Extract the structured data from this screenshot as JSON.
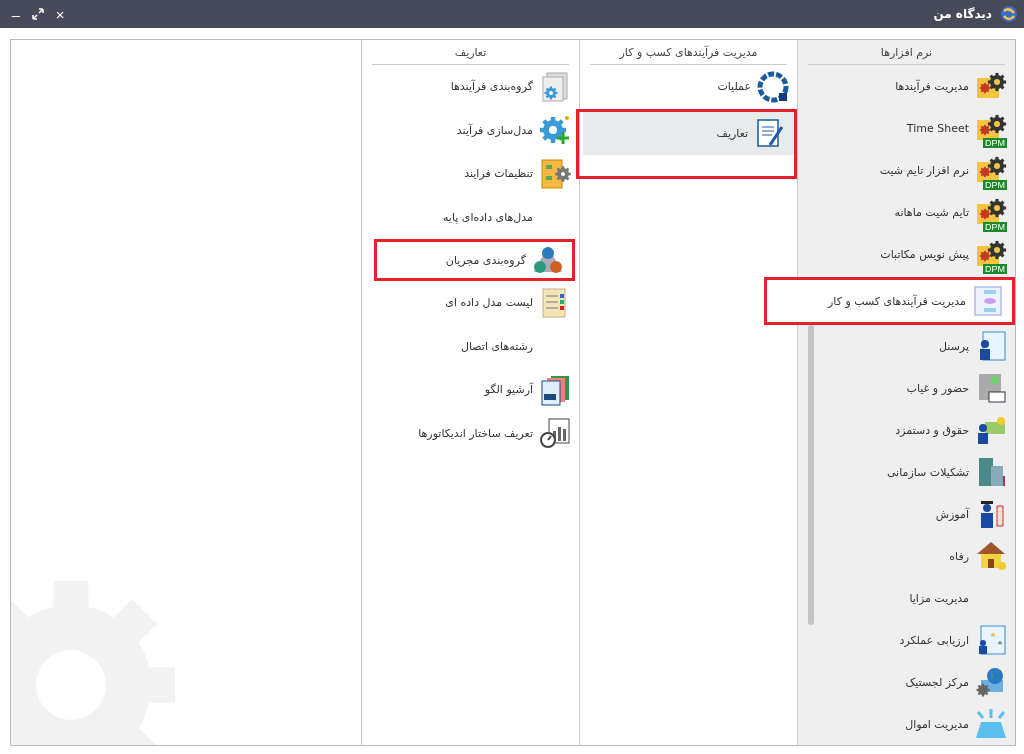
{
  "window": {
    "title": "دیدگاه من",
    "controls": [
      {
        "kind": "close",
        "glyph": "×"
      },
      {
        "kind": "maximize"
      },
      {
        "kind": "minimize",
        "glyph": "–"
      }
    ]
  },
  "columns": [
    {
      "header": "نرم افزارها",
      "scrollbar": true,
      "items": [
        {
          "label": "مدیریت فرآیندها",
          "kind": "gears",
          "selected": false,
          "highlighted": false
        },
        {
          "label": "Time Sheet",
          "kind": "gears",
          "badge": "DPM",
          "selected": false,
          "highlighted": false
        },
        {
          "label": "نرم افزار تایم شیت",
          "kind": "gears",
          "badge": "DPM",
          "selected": false,
          "highlighted": false
        },
        {
          "label": "تایم شیت ماهانه",
          "kind": "gears",
          "badge": "DPM",
          "selected": false,
          "highlighted": false
        },
        {
          "label": "پیش نویس مکاتبات",
          "kind": "gears",
          "badge": "DPM",
          "selected": false,
          "highlighted": false
        },
        {
          "label": "مدیریت فرآیندهای کسب و کار",
          "kind": "flowchart",
          "selected": true,
          "highlighted": true
        },
        {
          "label": "پرسنل",
          "kind": "person-doc",
          "selected": false,
          "highlighted": false
        },
        {
          "label": "حضور و غیاب",
          "kind": "terminal",
          "selected": false,
          "highlighted": false
        },
        {
          "label": "حقوق و دستمزد",
          "kind": "person-money",
          "selected": false,
          "highlighted": false
        },
        {
          "label": "تشکیلات سازمانی",
          "kind": "building",
          "selected": false,
          "highlighted": false
        },
        {
          "label": "آموزش",
          "kind": "graduate",
          "selected": false,
          "highlighted": false
        },
        {
          "label": "رفاه",
          "kind": "house",
          "selected": false,
          "highlighted": false
        },
        {
          "label": "مدیریت مزایا",
          "selected": false,
          "highlighted": false
        },
        {
          "label": "ارزیابی عملکرد",
          "kind": "stars-doc",
          "selected": false,
          "highlighted": false
        },
        {
          "label": "مرکز لجستیک",
          "kind": "globe-box",
          "selected": false,
          "highlighted": false
        },
        {
          "label": "مدیریت اموال",
          "kind": "alarm",
          "selected": false,
          "highlighted": false
        }
      ]
    },
    {
      "header": "مدیریت فرآیندهای کسب و کار",
      "items": [
        {
          "label": "عملیات",
          "kind": "wheel",
          "selected": false,
          "highlighted": false
        },
        {
          "label": "تعاریف",
          "kind": "doc-pencil",
          "selected": true,
          "highlighted": true
        }
      ]
    },
    {
      "header": "تعاریف",
      "items": [
        {
          "label": "گروه‌بندی فرآیندها",
          "kind": "gear-doc",
          "selected": false,
          "highlighted": false
        },
        {
          "label": "مدل‌سازی فرآیند",
          "kind": "gear-plus",
          "selected": false,
          "highlighted": false
        },
        {
          "label": "تنظیمات فرایند",
          "kind": "flow-gear",
          "selected": false,
          "highlighted": false
        },
        {
          "label": "مدل‌های داده‌ای پایه",
          "selected": false,
          "highlighted": false
        },
        {
          "label": "گروه‌بندی مجریان",
          "kind": "people",
          "selected": false,
          "highlighted": true
        },
        {
          "label": "لیست مدل داده ای",
          "kind": "list-doc",
          "selected": false,
          "highlighted": false
        },
        {
          "label": "رشته‌های اتصال",
          "selected": false,
          "highlighted": false
        },
        {
          "label": "آرشیو الگو",
          "kind": "doc-stack",
          "selected": false,
          "highlighted": false
        },
        {
          "label": "تعریف ساختار اندیکاتورها",
          "kind": "chart-gauge",
          "selected": false,
          "highlighted": false
        }
      ]
    }
  ]
}
